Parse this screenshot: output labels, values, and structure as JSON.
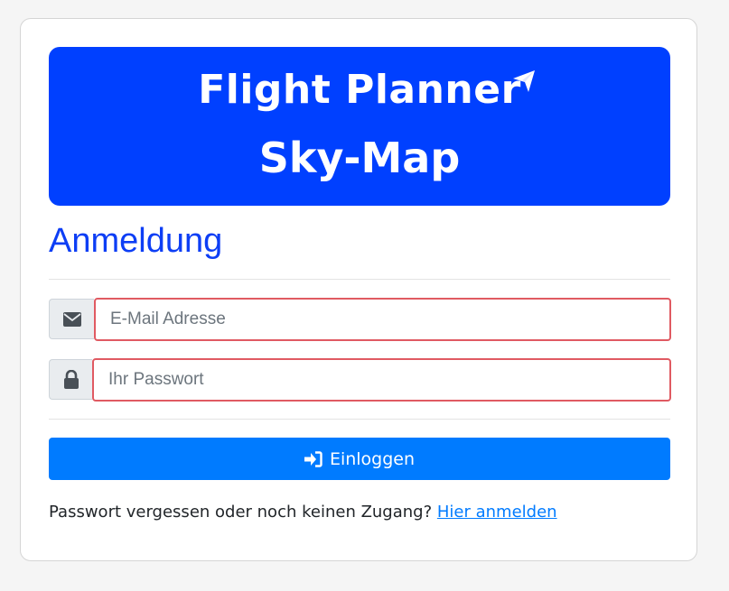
{
  "banner": {
    "title": "Flight Planner",
    "subtitle": "Sky-Map",
    "icon": "paper-plane-icon",
    "color": "#0040ff"
  },
  "form": {
    "heading": "Anmeldung",
    "email": {
      "icon": "envelope-icon",
      "placeholder": "E-Mail Adresse",
      "value": ""
    },
    "password": {
      "icon": "lock-icon",
      "placeholder": "Ihr Passwort",
      "value": ""
    },
    "submit": {
      "icon": "sign-in-icon",
      "label": "Einloggen",
      "color": "#007bff"
    }
  },
  "footer": {
    "text": "Passwort vergessen oder noch keinen Zugang?",
    "link_label": "Hier anmelden"
  }
}
